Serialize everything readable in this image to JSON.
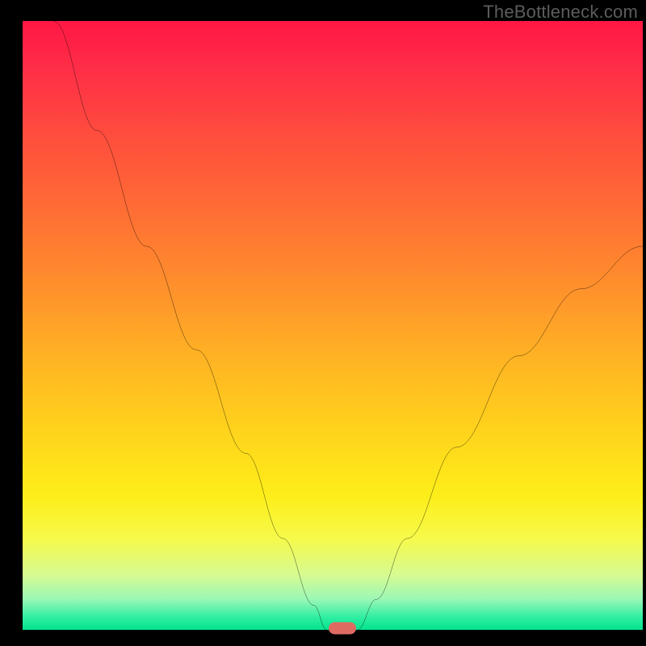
{
  "watermark": "TheBottleneck.com",
  "colors": {
    "frame_bg": "#000000",
    "curve_stroke": "#000000",
    "marker_fill": "#de6b62",
    "watermark_text": "#5c5c5c",
    "gradient_stops": [
      "#ff1744",
      "#ff2e47",
      "#ff4b3e",
      "#ff6a35",
      "#ff8b2d",
      "#ffb224",
      "#ffd21c",
      "#fdee1a",
      "#f6fa4a",
      "#d6fb92",
      "#9af7b6",
      "#2deea2",
      "#04e38f"
    ]
  },
  "chart_data": {
    "type": "line",
    "title": "",
    "xlabel": "",
    "ylabel": "",
    "xlim": [
      0,
      100
    ],
    "ylim": [
      0,
      100
    ],
    "left_branch": [
      {
        "x": 5,
        "y": 100
      },
      {
        "x": 12,
        "y": 82
      },
      {
        "x": 20,
        "y": 63
      },
      {
        "x": 28,
        "y": 46
      },
      {
        "x": 36,
        "y": 29
      },
      {
        "x": 42,
        "y": 15
      },
      {
        "x": 47,
        "y": 4
      },
      {
        "x": 49,
        "y": 0
      }
    ],
    "right_branch": [
      {
        "x": 54,
        "y": 0
      },
      {
        "x": 57,
        "y": 5
      },
      {
        "x": 62,
        "y": 15
      },
      {
        "x": 70,
        "y": 30
      },
      {
        "x": 80,
        "y": 45
      },
      {
        "x": 90,
        "y": 56
      },
      {
        "x": 100,
        "y": 63
      }
    ],
    "marker": {
      "x": 51.5,
      "y": 0
    },
    "description": "V-shaped bottleneck curve with minimum near x≈51 on a red-to-green vertical gradient (high=bad, low=good)."
  }
}
